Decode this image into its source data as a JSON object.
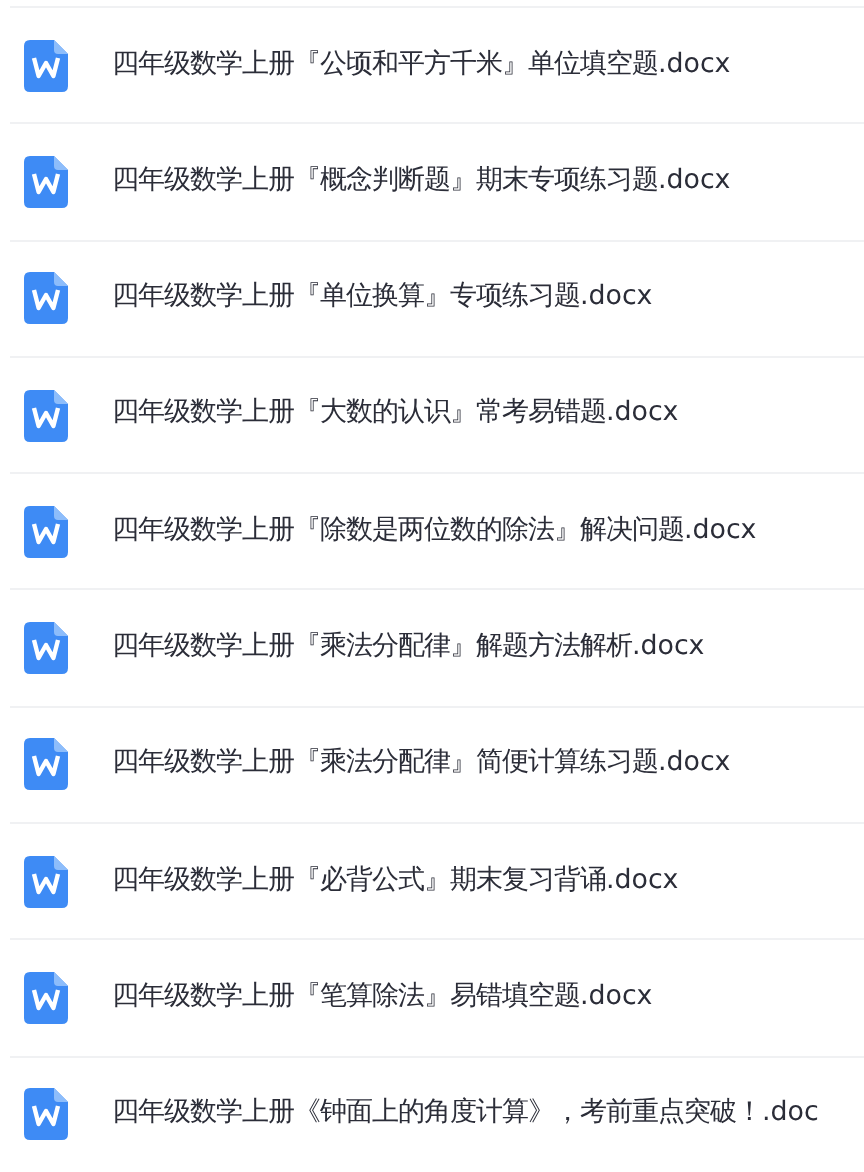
{
  "files": [
    {
      "name": "四年级数学上册『公顷和平方千米』单位填空题.docx"
    },
    {
      "name": "四年级数学上册『概念判断题』期末专项练习题.docx"
    },
    {
      "name": "四年级数学上册『单位换算』专项练习题.docx"
    },
    {
      "name": "四年级数学上册『大数的认识』常考易错题.docx"
    },
    {
      "name": "四年级数学上册『除数是两位数的除法』解决问题.docx"
    },
    {
      "name": "四年级数学上册『乘法分配律』解题方法解析.docx"
    },
    {
      "name": "四年级数学上册『乘法分配律』简便计算练习题.docx"
    },
    {
      "name": "四年级数学上册『必背公式』期末复习背诵.docx"
    },
    {
      "name": "四年级数学上册『笔算除法』易错填空题.docx"
    },
    {
      "name": "四年级数学上册《钟面上的角度计算》，考前重点突破！.doc"
    }
  ]
}
